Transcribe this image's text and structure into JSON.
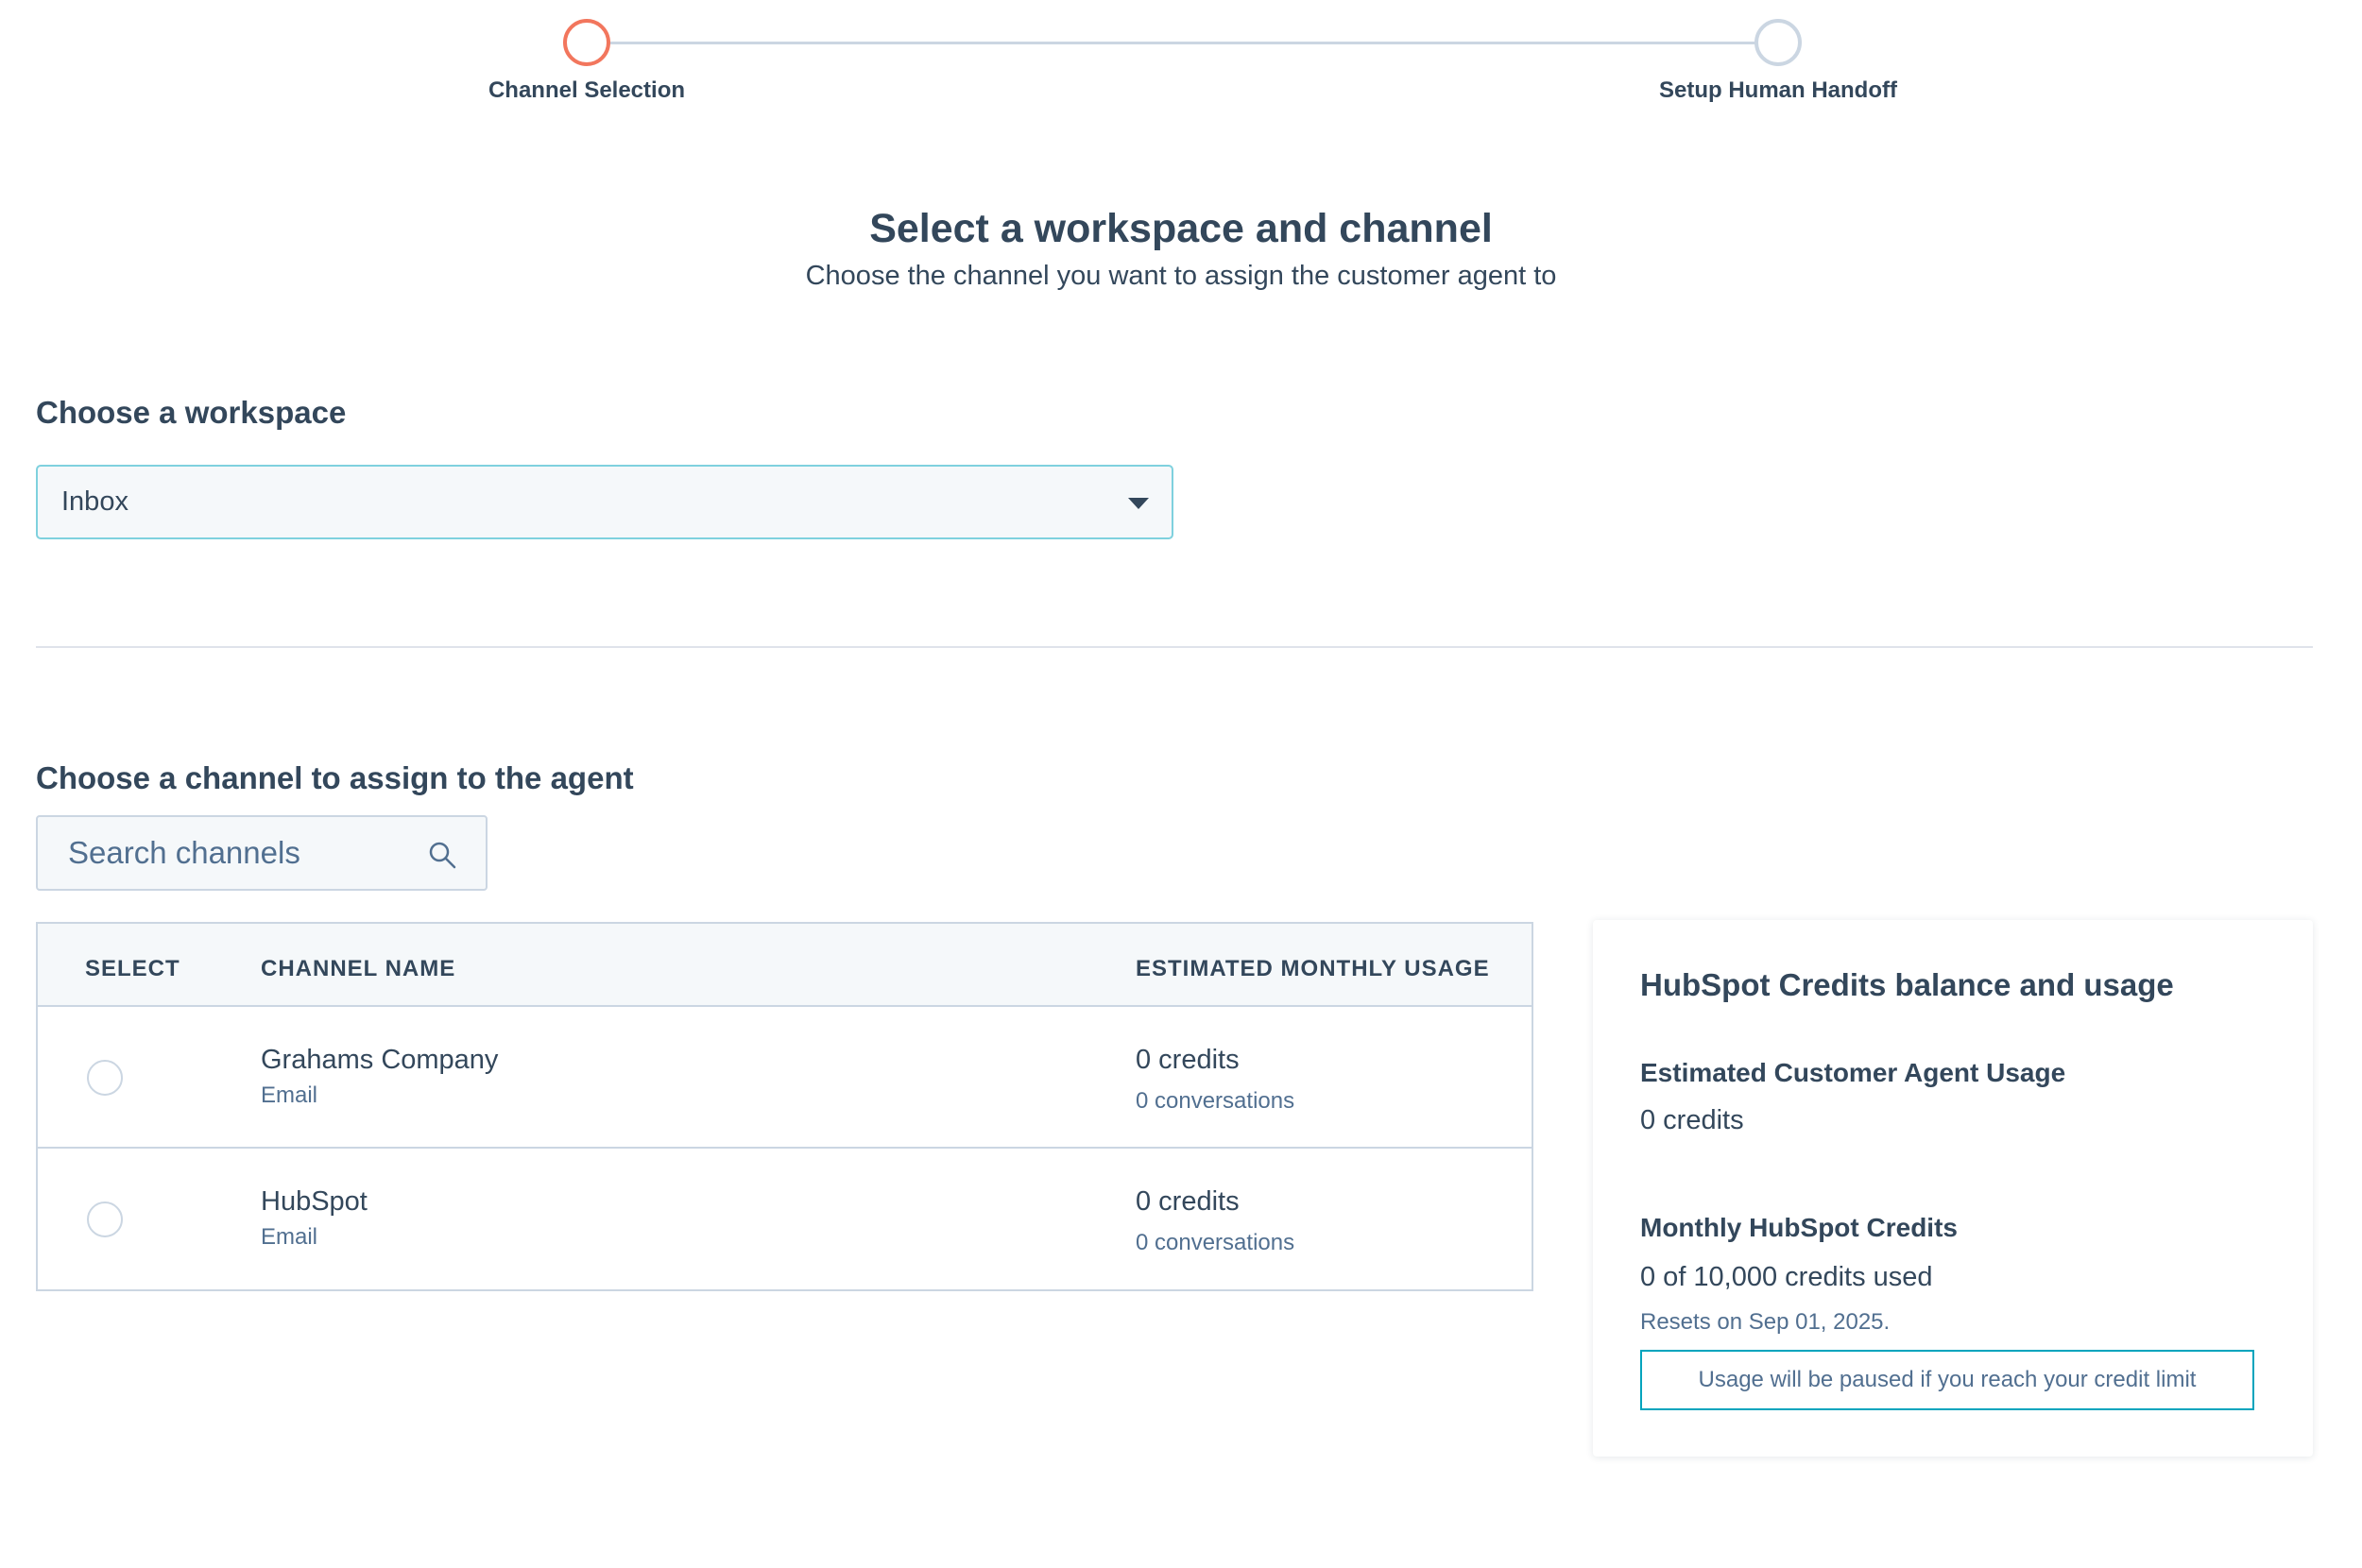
{
  "stepper": {
    "steps": [
      {
        "label": "Channel Selection",
        "state": "active"
      },
      {
        "label": "Setup Human Handoff",
        "state": "inactive"
      }
    ],
    "active_color": "#f2765d",
    "inactive_color": "#cbd6e2"
  },
  "header": {
    "title": "Select a workspace and channel",
    "subtitle": "Choose the channel you want to assign the customer agent to"
  },
  "workspace": {
    "heading": "Choose a workspace",
    "selected": "Inbox",
    "icon": "chevron-down-icon"
  },
  "channels": {
    "heading": "Choose a channel to assign to the agent",
    "search": {
      "placeholder": "Search channels",
      "value": "",
      "icon": "search-icon"
    },
    "columns": [
      "SELECT",
      "CHANNEL NAME",
      "ESTIMATED MONTHLY USAGE"
    ],
    "rows": [
      {
        "name": "Grahams Company",
        "type": "Email",
        "credits": "0 credits",
        "conversations": "0 conversations",
        "selected": false
      },
      {
        "name": "HubSpot",
        "type": "Email",
        "credits": "0 credits",
        "conversations": "0 conversations",
        "selected": false
      }
    ]
  },
  "credits_card": {
    "title": "HubSpot Credits balance and usage",
    "estimated_label": "Estimated Customer Agent Usage",
    "estimated_value": "0 credits",
    "monthly_label": "Monthly HubSpot Credits",
    "monthly_value": "0 of 10,000 credits used",
    "reset_text": "Resets on Sep 01, 2025.",
    "alert_text": "Usage will be paused if you reach your credit limit",
    "alert_color": "#00a4bd"
  }
}
